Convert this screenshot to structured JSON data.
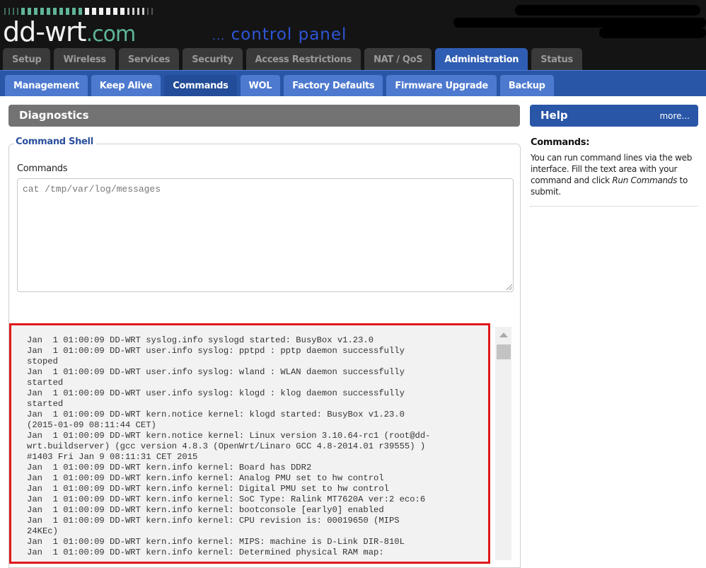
{
  "header": {
    "logo_main": "dd-wrt",
    "logo_suffix": ".com",
    "tagline_dots": "...",
    "tagline": "control panel",
    "signal_bars": {
      "green": 14,
      "white": 10,
      "dim": 6
    },
    "colors": {
      "background": "#141414",
      "logo_green": "#5fb597",
      "tagline_blue": "#2e55d6"
    }
  },
  "main_tabs": [
    {
      "label": "Setup",
      "active": false
    },
    {
      "label": "Wireless",
      "active": false
    },
    {
      "label": "Services",
      "active": false
    },
    {
      "label": "Security",
      "active": false
    },
    {
      "label": "Access Restrictions",
      "active": false
    },
    {
      "label": "NAT / QoS",
      "active": false
    },
    {
      "label": "Administration",
      "active": true
    },
    {
      "label": "Status",
      "active": false
    }
  ],
  "sub_tabs": [
    {
      "label": "Management",
      "active": false
    },
    {
      "label": "Keep Alive",
      "active": false
    },
    {
      "label": "Commands",
      "active": true
    },
    {
      "label": "WOL",
      "active": false
    },
    {
      "label": "Factory Defaults",
      "active": false
    },
    {
      "label": "Firmware Upgrade",
      "active": false
    },
    {
      "label": "Backup",
      "active": false
    }
  ],
  "content": {
    "section_title": "Diagnostics",
    "fieldset_legend": "Command Shell",
    "commands_label": "Commands",
    "commands_value": "cat /tmp/var/log/messages",
    "output_lines": [
      "Jan  1 01:00:09 DD-WRT syslog.info syslogd started: BusyBox v1.23.0",
      "Jan  1 01:00:09 DD-WRT user.info syslog: pptpd : pptp daemon successfully",
      "stoped",
      "Jan  1 01:00:09 DD-WRT user.info syslog: wland : WLAN daemon successfully",
      "started",
      "Jan  1 01:00:09 DD-WRT user.info syslog: klogd : klog daemon successfully",
      "started",
      "Jan  1 01:00:09 DD-WRT kern.notice kernel: klogd started: BusyBox v1.23.0",
      "(2015-01-09 08:11:44 CET)",
      "Jan  1 01:00:09 DD-WRT kern.notice kernel: Linux version 3.10.64-rc1 (root@dd-",
      "wrt.buildserver) (gcc version 4.8.3 (OpenWrt/Linaro GCC 4.8-2014.01 r39555) )",
      "#1403 Fri Jan 9 08:11:31 CET 2015",
      "Jan  1 01:00:09 DD-WRT kern.info kernel: Board has DDR2",
      "Jan  1 01:00:09 DD-WRT kern.info kernel: Analog PMU set to hw control",
      "Jan  1 01:00:09 DD-WRT kern.info kernel: Digital PMU set to hw control",
      "Jan  1 01:00:09 DD-WRT kern.info kernel: SoC Type: Ralink MT7620A ver:2 eco:6",
      "Jan  1 01:00:09 DD-WRT kern.info kernel: bootconsole [early0] enabled",
      "Jan  1 01:00:09 DD-WRT kern.info kernel: CPU revision is: 00019650 (MIPS",
      "24KEc)",
      "Jan  1 01:00:09 DD-WRT kern.info kernel: MIPS: machine is D-Link DIR-810L",
      "Jan  1 01:00:09 DD-WRT kern.info kernel: Determined physical RAM map:"
    ],
    "highlight_color": "#e0181b"
  },
  "help": {
    "title": "Help",
    "more_link": "more...",
    "heading": "Commands:",
    "text_before": "You can run command lines via the web interface. Fill the text area with your command and click ",
    "text_italic": "Run Commands",
    "text_after": " to submit."
  }
}
